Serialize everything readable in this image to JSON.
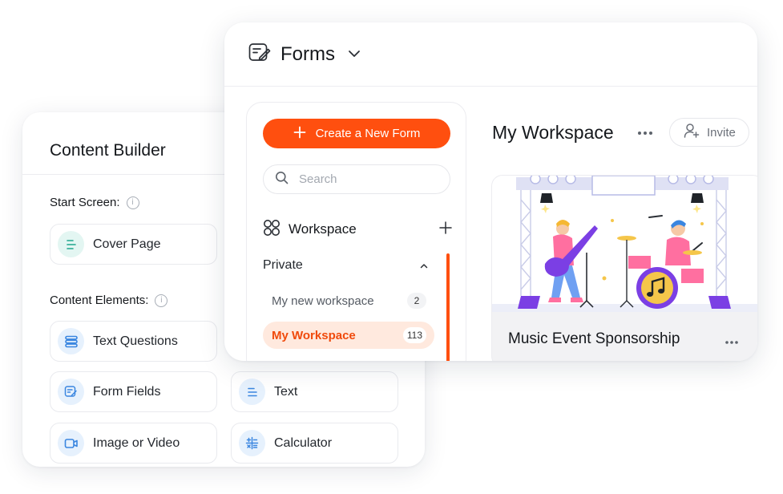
{
  "content_builder": {
    "title": "Content Builder",
    "start_screen_label": "Start Screen:",
    "start_items": [
      {
        "label": "Cover Page",
        "icon": "align-left-icon"
      }
    ],
    "content_elements_label": "Content Elements:",
    "element_items": [
      {
        "label": "Text Questions",
        "icon": "list-icon"
      },
      {
        "label": "Form Fields",
        "icon": "form-edit-icon"
      },
      {
        "label": "Text",
        "icon": "text-lines-icon"
      },
      {
        "label": "Image or Video",
        "icon": "video-icon"
      },
      {
        "label": "Calculator",
        "icon": "calculator-icon"
      }
    ],
    "info_glyph": "i"
  },
  "forms": {
    "title": "Forms",
    "create_button": "Create a New Form",
    "search_placeholder": "Search",
    "workspace_label": "Workspace",
    "private_label": "Private",
    "workspaces": [
      {
        "label": "My new workspace",
        "count": "2",
        "active": false
      },
      {
        "label": "My Workspace",
        "count": "113",
        "active": true
      }
    ],
    "main_title": "My Workspace",
    "invite_label": "Invite",
    "card_title": "Music Event Sponsorship"
  },
  "colors": {
    "accent": "#ff4f0f",
    "accent_soft": "#ffe9de",
    "teal_soft": "#e3f6f2",
    "blue_soft": "#e6f1fd",
    "illustration_purple": "#7b3fe4"
  }
}
